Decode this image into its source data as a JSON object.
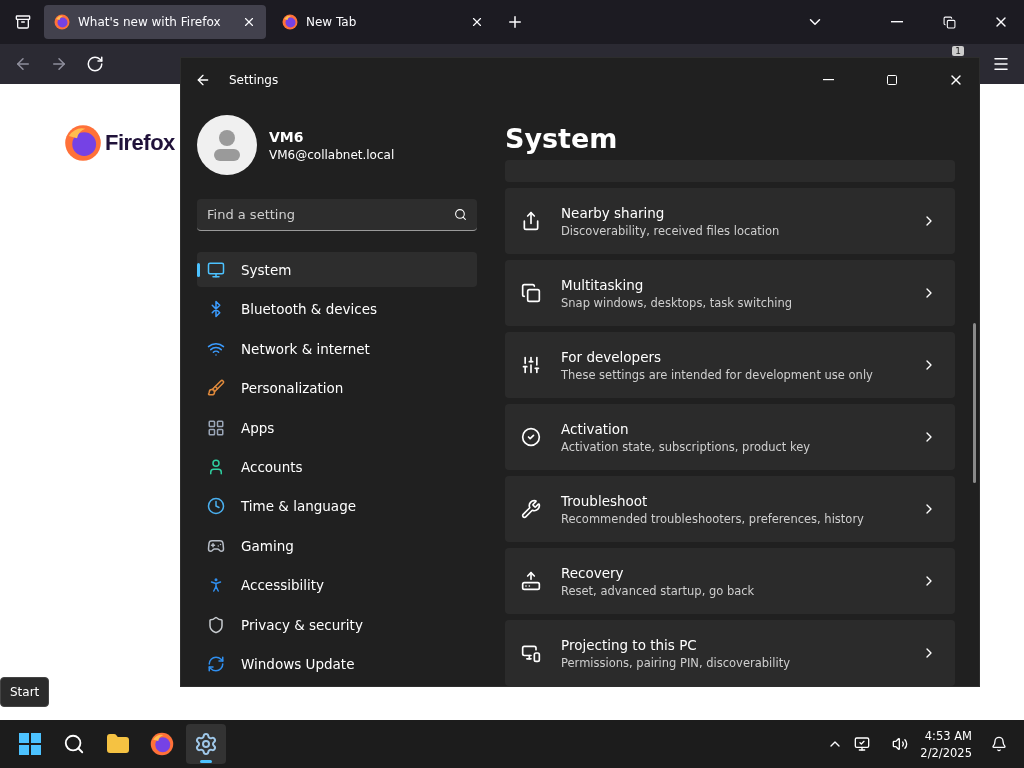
{
  "browser": {
    "tabs": [
      {
        "title": "What's new with Firefox",
        "selected": true
      },
      {
        "title": "New Tab",
        "selected": false
      }
    ],
    "toolbar_badge": "1",
    "page": {
      "logo_text": "Firefox"
    }
  },
  "settings": {
    "title": "Settings",
    "user": {
      "name": "VM6",
      "email": "VM6@collabnet.local"
    },
    "search": {
      "placeholder": "Find a setting"
    },
    "nav": [
      {
        "label": "System",
        "selected": true
      },
      {
        "label": "Bluetooth & devices",
        "selected": false
      },
      {
        "label": "Network & internet",
        "selected": false
      },
      {
        "label": "Personalization",
        "selected": false
      },
      {
        "label": "Apps",
        "selected": false
      },
      {
        "label": "Accounts",
        "selected": false
      },
      {
        "label": "Time & language",
        "selected": false
      },
      {
        "label": "Gaming",
        "selected": false
      },
      {
        "label": "Accessibility",
        "selected": false
      },
      {
        "label": "Privacy & security",
        "selected": false
      },
      {
        "label": "Windows Update",
        "selected": false
      }
    ],
    "heading": "System",
    "cards": [
      {
        "title": "Nearby sharing",
        "subtitle": "Discoverability, received files location"
      },
      {
        "title": "Multitasking",
        "subtitle": "Snap windows, desktops, task switching"
      },
      {
        "title": "For developers",
        "subtitle": "These settings are intended for development use only"
      },
      {
        "title": "Activation",
        "subtitle": "Activation state, subscriptions, product key"
      },
      {
        "title": "Troubleshoot",
        "subtitle": "Recommended troubleshooters, preferences, history"
      },
      {
        "title": "Recovery",
        "subtitle": "Reset, advanced startup, go back"
      },
      {
        "title": "Projecting to this PC",
        "subtitle": "Permissions, pairing PIN, discoverability"
      }
    ]
  },
  "tooltip": "Start",
  "taskbar": {
    "apps": [
      {
        "selected": false
      },
      {
        "selected": false
      },
      {
        "selected": false
      },
      {
        "selected": false
      },
      {
        "selected": true
      }
    ],
    "time": "4:53 AM",
    "date": "2/2/2025"
  }
}
